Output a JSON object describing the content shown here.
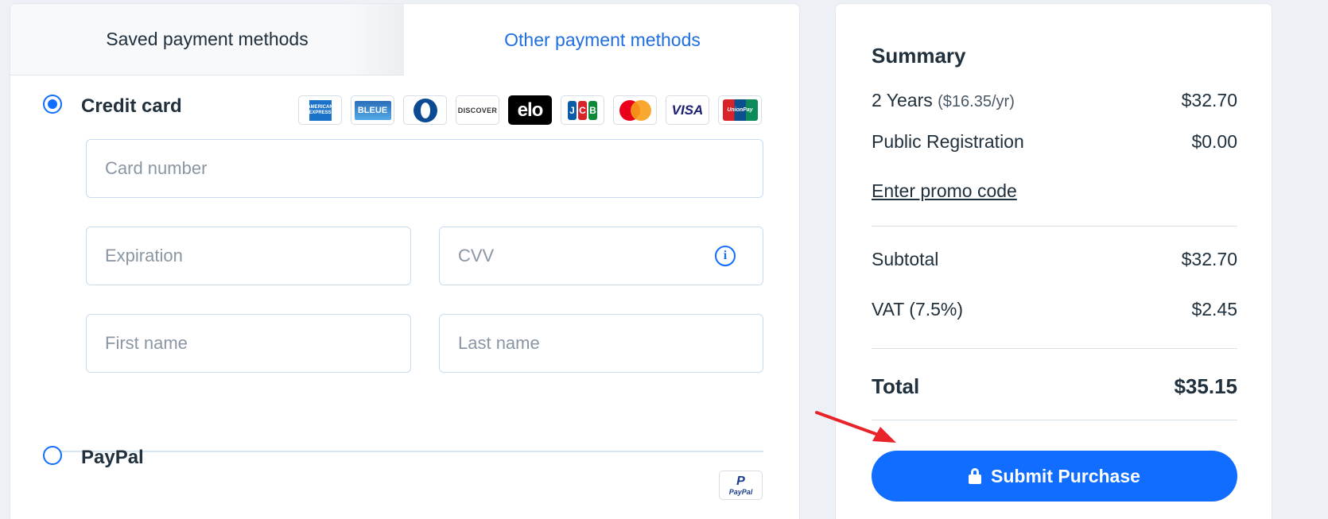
{
  "tabs": {
    "saved": "Saved payment methods",
    "other": "Other payment methods"
  },
  "credit_card": {
    "label": "Credit card",
    "selected": true,
    "logos": [
      "American Express",
      "CB Bleue",
      "Diners Club",
      "DISCOVER",
      "elo",
      "JCB",
      "Mastercard",
      "VISA",
      "UnionPay"
    ],
    "logo_text": {
      "amex": "AMERICAN EXPRESS",
      "bleue": "BLEUE",
      "discover": "DISCOVER",
      "elo": "elo",
      "jcb": [
        "J",
        "C",
        "B"
      ],
      "visa": "VISA",
      "unionpay": "UnionPay"
    },
    "fields": {
      "card_number": "Card number",
      "expiration": "Expiration",
      "cvv": "CVV",
      "first_name": "First name",
      "last_name": "Last name"
    },
    "info_icon_glyph": "i"
  },
  "paypal": {
    "label": "PayPal",
    "selected": false,
    "logo_p": "P",
    "logo_text": "PayPal"
  },
  "summary": {
    "title": "Summary",
    "plan_label": "2 Years",
    "plan_rate": "($16.35/yr)",
    "plan_price": "$32.70",
    "registration_label": "Public Registration",
    "registration_price": "$0.00",
    "promo_link": "Enter promo code",
    "subtotal_label": "Subtotal",
    "subtotal_value": "$32.70",
    "vat_label": "VAT (7.5%)",
    "vat_value": "$2.45",
    "total_label": "Total",
    "total_value": "$35.15",
    "submit_label": "Submit Purchase"
  },
  "colors": {
    "accent": "#116dff",
    "annotation_arrow": "#e8232a"
  }
}
